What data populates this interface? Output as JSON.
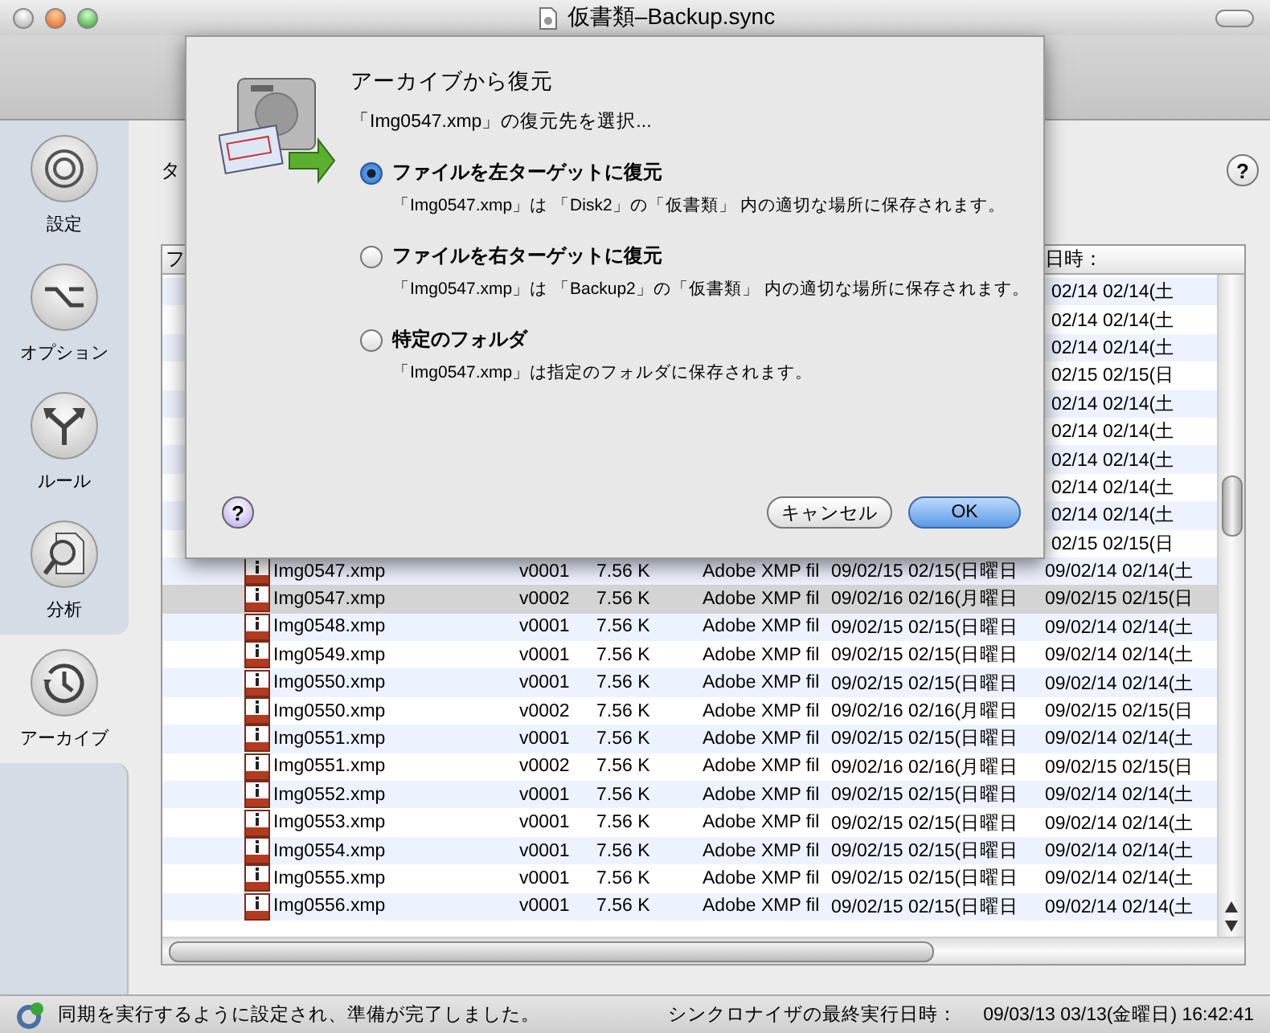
{
  "window": {
    "title": "仮書類–Backup.sync"
  },
  "sidebar": {
    "items": [
      {
        "label": "設定",
        "selected": false
      },
      {
        "label": "オプション",
        "selected": false
      },
      {
        "label": "ルール",
        "selected": false
      },
      {
        "label": "分析",
        "selected": false
      },
      {
        "label": "アーカイブ",
        "selected": true
      }
    ]
  },
  "content": {
    "partial_label": "タ",
    "help_button": "?"
  },
  "table": {
    "columns": [
      "フ",
      "日時："
    ],
    "rows_behind_dialog": [
      {
        "created": "02/14 02/14(土"
      },
      {
        "created": "02/14 02/14(土"
      },
      {
        "created": "02/14 02/14(土"
      },
      {
        "created": "02/15 02/15(日"
      },
      {
        "created": "02/14 02/14(土"
      },
      {
        "created": "02/14 02/14(土"
      },
      {
        "created": "02/14 02/14(土"
      },
      {
        "created": "02/14 02/14(土"
      },
      {
        "created": "02/14 02/14(土"
      },
      {
        "created": "02/15 02/15(日"
      }
    ],
    "rows": [
      {
        "name": "Img0547.xmp",
        "version": "v0001",
        "size": "7.56 K",
        "kind": "Adobe XMP fil",
        "modified": "09/02/15 02/15(日曜日",
        "created": "09/02/14 02/14(土",
        "selected": false
      },
      {
        "name": "Img0547.xmp",
        "version": "v0002",
        "size": "7.56 K",
        "kind": "Adobe XMP fil",
        "modified": "09/02/16 02/16(月曜日",
        "created": "09/02/15 02/15(日",
        "selected": true
      },
      {
        "name": "Img0548.xmp",
        "version": "v0001",
        "size": "7.56 K",
        "kind": "Adobe XMP fil",
        "modified": "09/02/15 02/15(日曜日",
        "created": "09/02/14 02/14(土",
        "selected": false
      },
      {
        "name": "Img0549.xmp",
        "version": "v0001",
        "size": "7.56 K",
        "kind": "Adobe XMP fil",
        "modified": "09/02/15 02/15(日曜日",
        "created": "09/02/14 02/14(土",
        "selected": false
      },
      {
        "name": "Img0550.xmp",
        "version": "v0001",
        "size": "7.56 K",
        "kind": "Adobe XMP fil",
        "modified": "09/02/15 02/15(日曜日",
        "created": "09/02/14 02/14(土",
        "selected": false
      },
      {
        "name": "Img0550.xmp",
        "version": "v0002",
        "size": "7.56 K",
        "kind": "Adobe XMP fil",
        "modified": "09/02/16 02/16(月曜日",
        "created": "09/02/15 02/15(日",
        "selected": false
      },
      {
        "name": "Img0551.xmp",
        "version": "v0001",
        "size": "7.56 K",
        "kind": "Adobe XMP fil",
        "modified": "09/02/15 02/15(日曜日",
        "created": "09/02/14 02/14(土",
        "selected": false
      },
      {
        "name": "Img0551.xmp",
        "version": "v0002",
        "size": "7.56 K",
        "kind": "Adobe XMP fil",
        "modified": "09/02/16 02/16(月曜日",
        "created": "09/02/15 02/15(日",
        "selected": false
      },
      {
        "name": "Img0552.xmp",
        "version": "v0001",
        "size": "7.56 K",
        "kind": "Adobe XMP fil",
        "modified": "09/02/15 02/15(日曜日",
        "created": "09/02/14 02/14(土",
        "selected": false
      },
      {
        "name": "Img0553.xmp",
        "version": "v0001",
        "size": "7.56 K",
        "kind": "Adobe XMP fil",
        "modified": "09/02/15 02/15(日曜日",
        "created": "09/02/14 02/14(土",
        "selected": false
      },
      {
        "name": "Img0554.xmp",
        "version": "v0001",
        "size": "7.56 K",
        "kind": "Adobe XMP fil",
        "modified": "09/02/15 02/15(日曜日",
        "created": "09/02/14 02/14(土",
        "selected": false
      },
      {
        "name": "Img0555.xmp",
        "version": "v0001",
        "size": "7.56 K",
        "kind": "Adobe XMP fil",
        "modified": "09/02/15 02/15(日曜日",
        "created": "09/02/14 02/14(土",
        "selected": false
      },
      {
        "name": "Img0556.xmp",
        "version": "v0001",
        "size": "7.56 K",
        "kind": "Adobe XMP fil",
        "modified": "09/02/15 02/15(日曜日",
        "created": "09/02/14 02/14(土",
        "selected": false
      }
    ]
  },
  "dialog": {
    "title": "アーカイブから復元",
    "subtitle": "「Img0547.xmp」の復元先を選択...",
    "options": [
      {
        "label": "ファイルを左ターゲットに復元",
        "description": "「Img0547.xmp」は 「Disk2」の「仮書類」 内の適切な場所に保存されます。",
        "selected": true
      },
      {
        "label": "ファイルを右ターゲットに復元",
        "description": "「Img0547.xmp」は 「Backup2」の「仮書類」 内の適切な場所に保存されます。",
        "selected": false
      },
      {
        "label": "特定のフォルダ",
        "description": "「Img0547.xmp」は指定のフォルダに保存されます。",
        "selected": false
      }
    ],
    "help_button": "?",
    "buttons": [
      {
        "label": "キャンセル",
        "default": false
      },
      {
        "label": "OK",
        "default": true
      }
    ]
  },
  "status_bar": {
    "message": "同期を実行するように設定され、準備が完了しました。",
    "last_run_label": "シンクロナイザの最終実行日時：",
    "last_run_value": "09/03/13 03/13(金曜日) 16:42:41"
  }
}
